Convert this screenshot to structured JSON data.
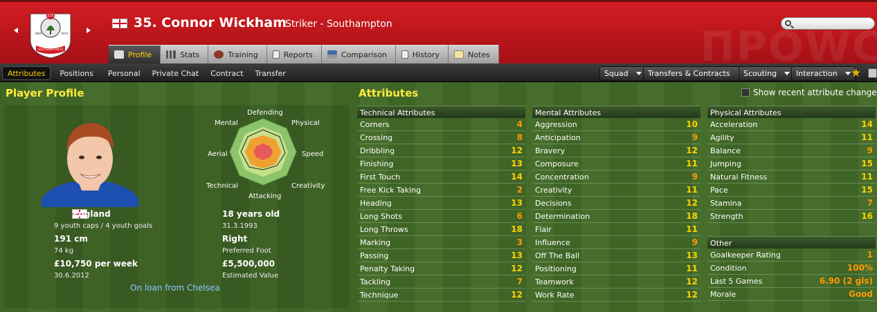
{
  "header": {
    "number_name": "35. Connor Wickham",
    "position_club": "Striker - Southampton",
    "crest_text": "SOUTHAMPTON FC",
    "crest_number": "125",
    "crest_years_left": "1885",
    "crest_years_right": "2010",
    "watermark": "ΠΡΟWC"
  },
  "tabs": [
    {
      "label": "Profile",
      "icon": "profile-card-icon"
    },
    {
      "label": "Stats",
      "icon": "stats-bars-icon"
    },
    {
      "label": "Training",
      "icon": "training-ball-icon"
    },
    {
      "label": "Reports",
      "icon": "report-document-icon"
    },
    {
      "label": "Comparison",
      "icon": "comparison-icon"
    },
    {
      "label": "History",
      "icon": "history-icon"
    },
    {
      "label": "Notes",
      "icon": "notes-icon"
    }
  ],
  "subtabs": [
    "Attributes",
    "Positions",
    "Personal",
    "Private Chat",
    "Contract",
    "Transfer"
  ],
  "menus": {
    "squad": "Squad",
    "transfers": "Transfers & Contracts",
    "scouting": "Scouting",
    "interaction": "Interaction"
  },
  "profile": {
    "heading": "Player Profile",
    "nation": "England",
    "youth": "9 youth caps / 4 youth goals",
    "age": "18 years old",
    "dob": "31.3.1993",
    "height": "191 cm",
    "weight": "74 kg",
    "foot": "Right",
    "foot_label": "Preferred Foot",
    "wage": "£10,750 per week",
    "contract_end": "30.6.2012",
    "value": "£5,500,000",
    "value_label": "Estimated Value",
    "loan": "On loan from Chelsea"
  },
  "radar_labels": {
    "defending": "Defending",
    "physical": "Physical",
    "speed": "Speed",
    "creativity": "Creativity",
    "attacking": "Attacking",
    "technical": "Technical",
    "aerial": "Aerial",
    "mental": "Mental"
  },
  "attributes_heading": "Attributes",
  "show_recent": "Show recent attribute changes",
  "technical": {
    "title": "Technical Attributes",
    "rows": [
      {
        "name": "Corners",
        "value": "4"
      },
      {
        "name": "Crossing",
        "value": "8"
      },
      {
        "name": "Dribbling",
        "value": "12"
      },
      {
        "name": "Finishing",
        "value": "13"
      },
      {
        "name": "First Touch",
        "value": "14"
      },
      {
        "name": "Free Kick Taking",
        "value": "2"
      },
      {
        "name": "Heading",
        "value": "13"
      },
      {
        "name": "Long Shots",
        "value": "6"
      },
      {
        "name": "Long Throws",
        "value": "18"
      },
      {
        "name": "Marking",
        "value": "3"
      },
      {
        "name": "Passing",
        "value": "13"
      },
      {
        "name": "Penalty Taking",
        "value": "12"
      },
      {
        "name": "Tackling",
        "value": "7"
      },
      {
        "name": "Technique",
        "value": "12"
      }
    ]
  },
  "mental": {
    "title": "Mental Attributes",
    "rows": [
      {
        "name": "Aggression",
        "value": "10"
      },
      {
        "name": "Anticipation",
        "value": "9"
      },
      {
        "name": "Bravery",
        "value": "12"
      },
      {
        "name": "Composure",
        "value": "11"
      },
      {
        "name": "Concentration",
        "value": "9"
      },
      {
        "name": "Creativity",
        "value": "11"
      },
      {
        "name": "Decisions",
        "value": "12"
      },
      {
        "name": "Determination",
        "value": "18"
      },
      {
        "name": "Flair",
        "value": "11"
      },
      {
        "name": "Influence",
        "value": "9"
      },
      {
        "name": "Off The Ball",
        "value": "13"
      },
      {
        "name": "Positioning",
        "value": "11"
      },
      {
        "name": "Teamwork",
        "value": "12"
      },
      {
        "name": "Work Rate",
        "value": "12"
      }
    ]
  },
  "physical": {
    "title": "Physical Attributes",
    "rows": [
      {
        "name": "Acceleration",
        "value": "14"
      },
      {
        "name": "Agility",
        "value": "11"
      },
      {
        "name": "Balance",
        "value": "9"
      },
      {
        "name": "Jumping",
        "value": "15"
      },
      {
        "name": "Natural Fitness",
        "value": "11"
      },
      {
        "name": "Pace",
        "value": "15"
      },
      {
        "name": "Stamina",
        "value": "7"
      },
      {
        "name": "Strength",
        "value": "16"
      }
    ]
  },
  "other": {
    "title": "Other",
    "rows": [
      {
        "name": "Goalkeeper Rating",
        "value": "1"
      },
      {
        "name": "Condition",
        "value": "100%"
      },
      {
        "name": "Last 5 Games",
        "value": "6.90 (2 gls)"
      },
      {
        "name": "Morale",
        "value": "Good"
      }
    ]
  },
  "colors": {
    "high": "#ffd200",
    "low": "#ff9a00",
    "accent": "#d21d22"
  }
}
